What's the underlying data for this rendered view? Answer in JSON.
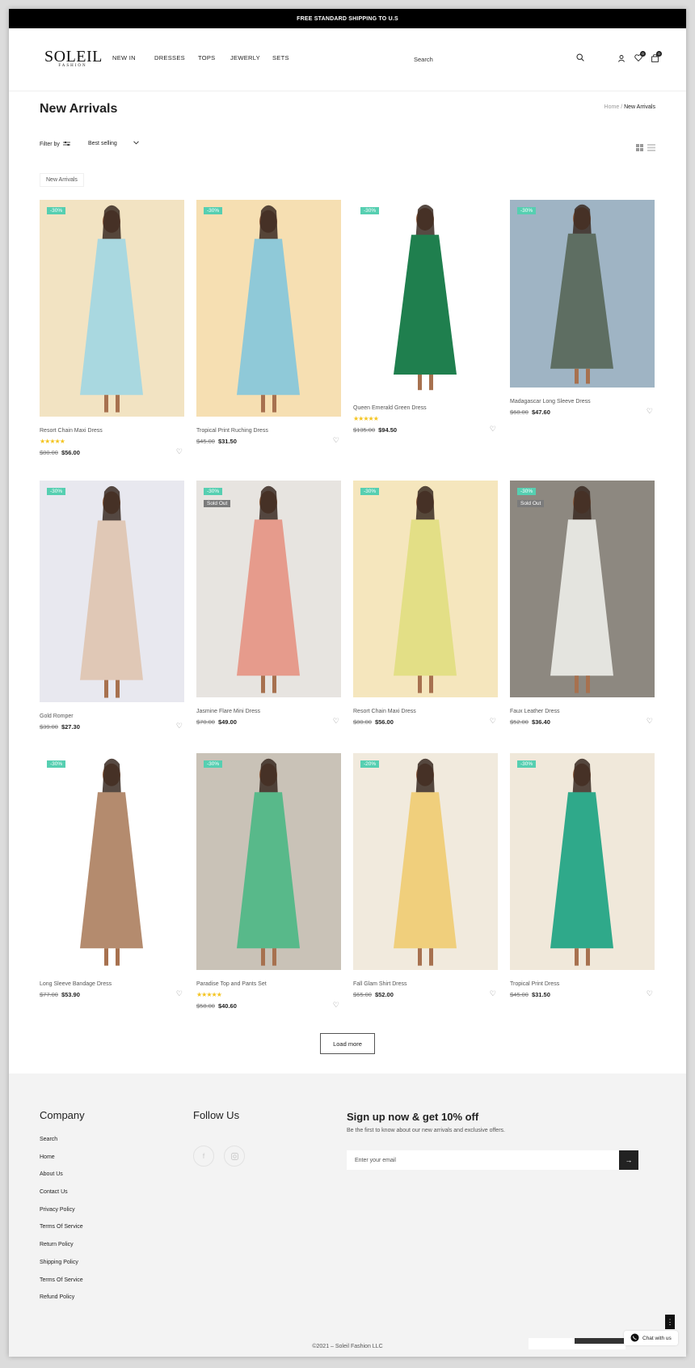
{
  "announcement": "FREE STANDARD SHIPPING TO U.S",
  "brand": {
    "name": "SOLEIL",
    "sub": "FASHION"
  },
  "nav": [
    "NEW IN",
    "DRESSES",
    "TOPS",
    "JEWERLY",
    "SETS"
  ],
  "header": {
    "search_label": "Search",
    "wishlist_count": "0",
    "cart_count": "0"
  },
  "page_title": "New Arrivals",
  "breadcrumb": {
    "home": "Home",
    "sep": "/",
    "current": "New Arrivals"
  },
  "filter": {
    "label": "Filter by",
    "sort": "Best selling"
  },
  "tag": "New Arrivals",
  "products": [
    {
      "name": "Resort Chain Maxi Dress",
      "discount": "-30%",
      "rating": "★★★★★",
      "old": "$80.00",
      "new": "$56.00",
      "sold": "",
      "bg": "#f2e3c2",
      "dress": "#a9d8e0"
    },
    {
      "name": "Tropical Print Ruching Dress",
      "discount": "-30%",
      "rating": "",
      "old": "$45.00",
      "new": "$31.50",
      "sold": "",
      "bg": "#f6dfb2",
      "dress": "#8fc9d8"
    },
    {
      "name": "Queen Emerald Green Dress",
      "discount": "-30%",
      "rating": "★★★★★",
      "old": "$135.00",
      "new": "$94.50",
      "sold": "",
      "bg": "#ffffff",
      "dress": "#1f7f4e"
    },
    {
      "name": "Madagascar Long Sleeve Dress",
      "discount": "-30%",
      "rating": "",
      "old": "$68.00",
      "new": "$47.60",
      "sold": "",
      "bg": "#9fb4c4",
      "dress": "#5e6e62"
    },
    {
      "name": "Gold Romper",
      "discount": "-30%",
      "rating": "",
      "old": "$39.00",
      "new": "$27.30",
      "sold": "",
      "bg": "#e8e8ef",
      "dress": "#e0c8b6"
    },
    {
      "name": "Jasmine Flare Mini Dress",
      "discount": "-30%",
      "rating": "",
      "old": "$70.00",
      "new": "$49.00",
      "sold": "Sold Out",
      "bg": "#e7e4e0",
      "dress": "#e69b8c"
    },
    {
      "name": "Resort Chain Maxi Dress",
      "discount": "-30%",
      "rating": "",
      "old": "$80.00",
      "new": "$56.00",
      "sold": "",
      "bg": "#f5e6bd",
      "dress": "#e3df86"
    },
    {
      "name": "Faux Leather Dress",
      "discount": "-30%",
      "rating": "",
      "old": "$52.00",
      "new": "$36.40",
      "sold": "Sold Out",
      "bg": "#8d8880",
      "dress": "#e4e4df"
    },
    {
      "name": "Long Sleeve Bandage Dress",
      "discount": "-30%",
      "rating": "",
      "old": "$77.00",
      "new": "$53.90",
      "sold": "",
      "bg": "#ffffff",
      "dress": "#b48b6e"
    },
    {
      "name": "Paradise Top and Pants Set",
      "discount": "-30%",
      "rating": "★★★★★",
      "old": "$58.00",
      "new": "$40.60",
      "sold": "",
      "bg": "#c9c2b7",
      "dress": "#58b98a"
    },
    {
      "name": "Fall Glam Shirt Dress",
      "discount": "-20%",
      "rating": "",
      "old": "$65.00",
      "new": "$52.00",
      "sold": "",
      "bg": "#f1eadd",
      "dress": "#f0cf7c"
    },
    {
      "name": "Tropical Print Dress",
      "discount": "-30%",
      "rating": "",
      "old": "$45.00",
      "new": "$31.50",
      "sold": "",
      "bg": "#f0e8da",
      "dress": "#2fa98a"
    }
  ],
  "load_more": "Load more",
  "footer": {
    "company_heading": "Company",
    "links": [
      "Search",
      "Home",
      "About Us",
      "Contact Us",
      "Privacy Policy",
      "Terms Of Service",
      "Return Policy",
      "Shipping Policy",
      "Terms Of Service",
      "Refund Policy"
    ],
    "follow_heading": "Follow Us",
    "signup_heading": "Sign up now & get 10% off",
    "signup_sub": "Be the first to know about our new arrivals and exclusive offers.",
    "email_placeholder": "Enter your email",
    "copyright": "©2021 – Soleil Fashion LLC",
    "chat_label": "Chat with us"
  },
  "icons": {
    "search": "search-icon",
    "account": "user-icon",
    "wishlist": "heart-icon",
    "cart": "bag-icon",
    "filter": "sliders-icon",
    "sort": "chevron-down-icon",
    "grid": "grid-icon",
    "list": "list-icon",
    "email_submit": "arrow-right-icon",
    "social": [
      "facebook-icon",
      "instagram-icon"
    ],
    "chat": "whatsapp-icon"
  }
}
